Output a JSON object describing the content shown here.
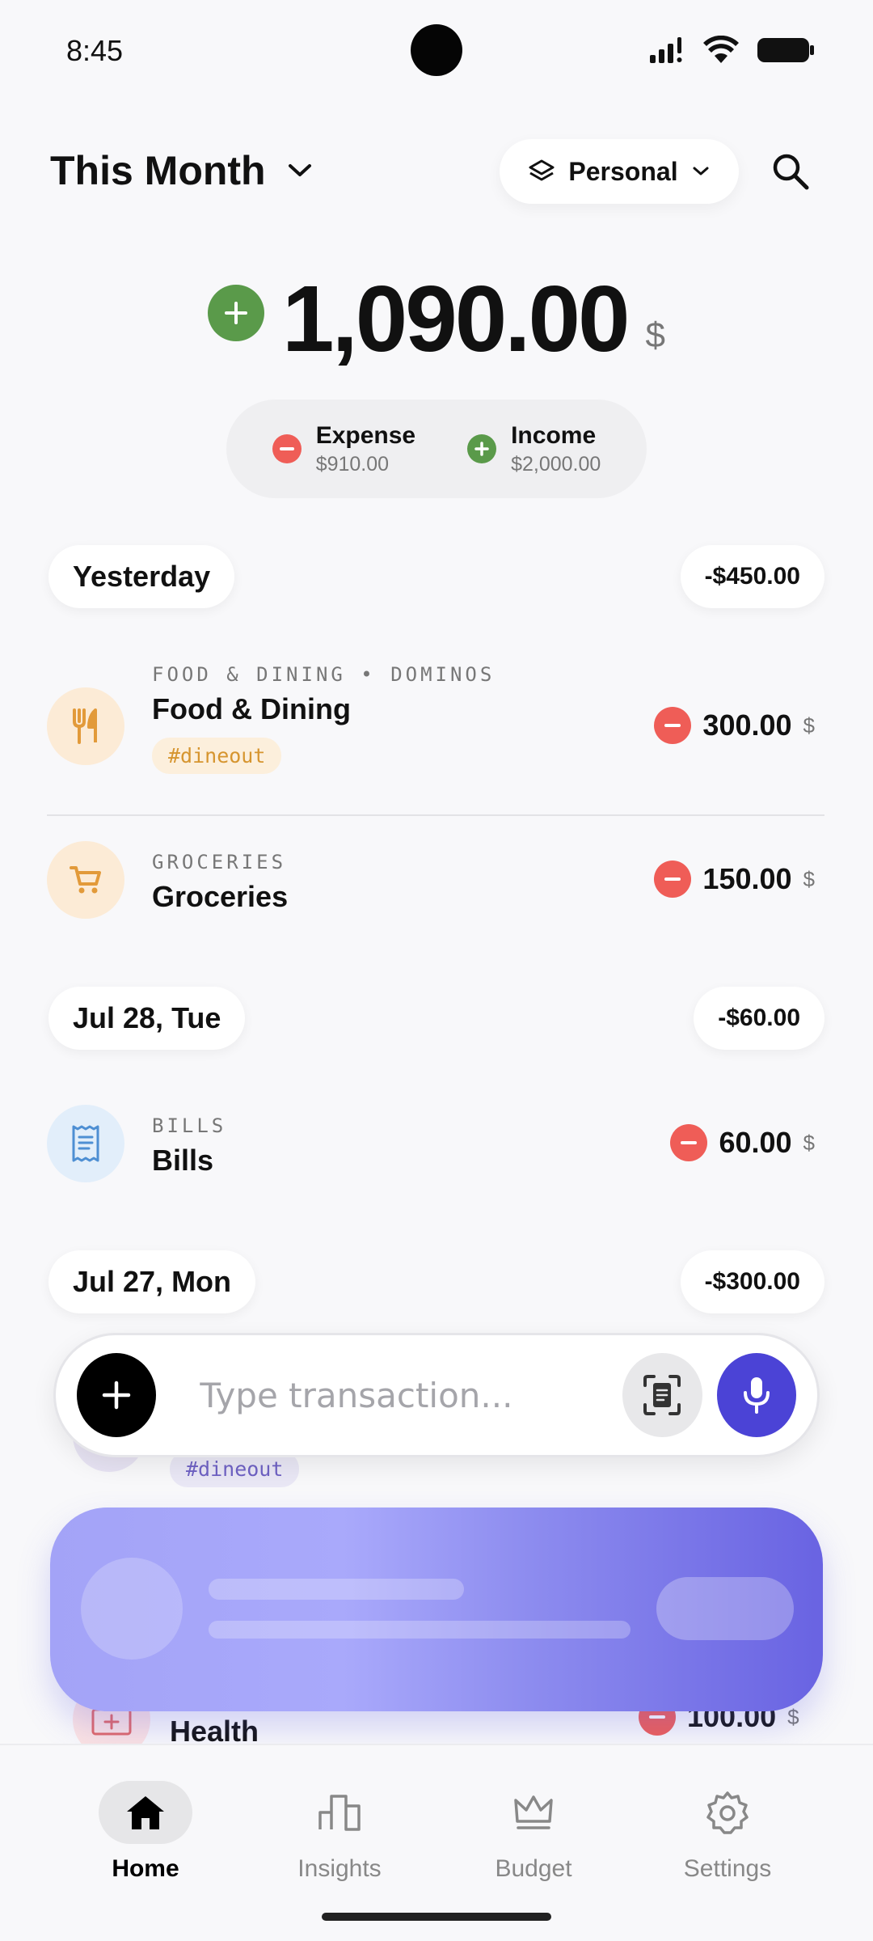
{
  "status_bar": {
    "time": "8:45"
  },
  "header": {
    "period": "This Month",
    "account": "Personal"
  },
  "balance": {
    "amount": "1,090.00",
    "currency": "$",
    "expense_label": "Expense",
    "expense_value": "$910.00",
    "income_label": "Income",
    "income_value": "$2,000.00"
  },
  "groups": [
    {
      "date": "Yesterday",
      "total": "-$450.00"
    },
    {
      "date": "Jul 28, Tue",
      "total": "-$60.00"
    },
    {
      "date": "Jul 27, Mon",
      "total": "-$300.00"
    }
  ],
  "transactions": [
    {
      "meta": "FOOD & DINING  •  DOMINOS",
      "name": "Food & Dining",
      "tag": "#dineout",
      "amount": "300.00",
      "currency": "$",
      "icon": "fork-knife-icon"
    },
    {
      "meta": "GROCERIES",
      "name": "Groceries",
      "amount": "150.00",
      "currency": "$",
      "icon": "cart-icon"
    },
    {
      "meta": "BILLS",
      "name": "Bills",
      "amount": "60.00",
      "currency": "$",
      "icon": "receipt-icon"
    },
    {
      "tag": "#dineout"
    },
    {
      "name": "Health",
      "amount": "100.00",
      "currency": "$",
      "icon": "medical-kit-icon"
    }
  ],
  "input": {
    "placeholder": "Type transaction..."
  },
  "nav": [
    {
      "label": "Home",
      "active": true
    },
    {
      "label": "Insights"
    },
    {
      "label": "Budget"
    },
    {
      "label": "Settings"
    }
  ],
  "colors": {
    "income": "#5a9a4a",
    "expense": "#ef5d57",
    "accent": "#4b43d6"
  }
}
